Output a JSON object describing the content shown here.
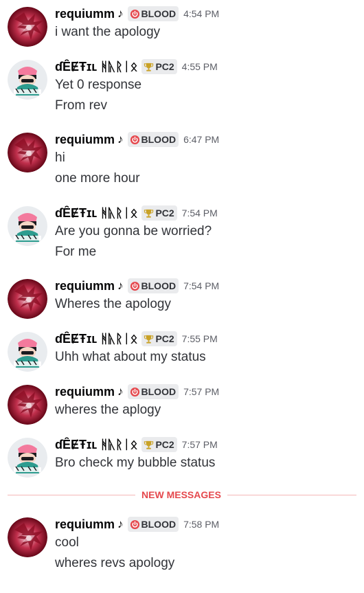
{
  "users": {
    "requiumm": {
      "name": "requiumm",
      "suffix": "♪",
      "tag": "BLOOD",
      "tag_icon": "power-icon",
      "tag_color": "#e5484d"
    },
    "devil": {
      "name": "ɗȆɆŦɪʟ ᚻᚣᚱᛁᛟ",
      "suffix": "",
      "tag": "PC2",
      "tag_icon": "trophy-icon",
      "tag_color": "#c9a227"
    }
  },
  "messages": [
    {
      "user": "requiumm",
      "time": "4:54 PM",
      "lines": [
        "i want the apology"
      ]
    },
    {
      "user": "devil",
      "time": "4:55 PM",
      "lines": [
        "Yet 0 response",
        "From rev"
      ]
    },
    {
      "user": "requiumm",
      "time": "6:47 PM",
      "lines": [
        "hi",
        "one more hour"
      ]
    },
    {
      "user": "devil",
      "time": "7:54 PM",
      "lines": [
        "Are you gonna be worried?",
        "For me"
      ]
    },
    {
      "user": "requiumm",
      "time": "7:54 PM",
      "lines": [
        "Wheres the apology"
      ]
    },
    {
      "user": "devil",
      "time": "7:55 PM",
      "lines": [
        "Uhh what about my status"
      ]
    },
    {
      "user": "requiumm",
      "time": "7:57 PM",
      "lines": [
        "wheres the aplogy"
      ]
    },
    {
      "user": "devil",
      "time": "7:57 PM",
      "lines": [
        "Bro check my bubble status"
      ]
    },
    {
      "user": "requiumm",
      "time": "7:58 PM",
      "lines": [
        "cool",
        "wheres revs apology"
      ]
    }
  ],
  "divider": {
    "label": "NEW MESSAGES",
    "color": "#e5484d"
  },
  "colors": {
    "background": "#ffffff",
    "username": "#060607",
    "message_text": "#313338",
    "timestamp": "#5c5e66",
    "tag_background": "#eaebed"
  }
}
